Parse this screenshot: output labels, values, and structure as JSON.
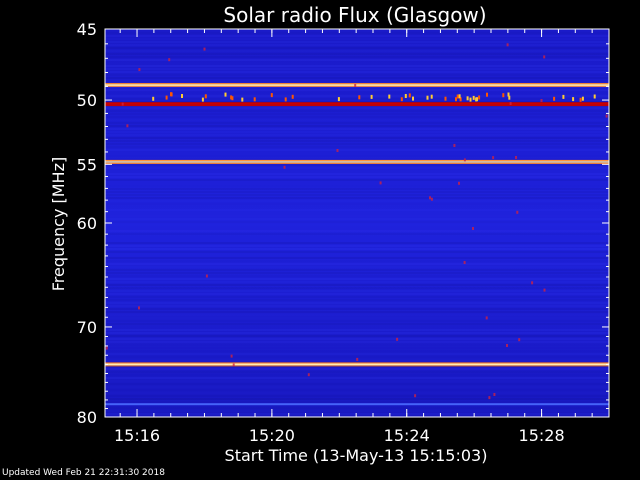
{
  "chart_data": {
    "type": "heatmap",
    "title": "Solar radio Flux (Glasgow)",
    "xlabel": "Start Time (13-May-13 15:15:03)",
    "ylabel": "Frequency [MHz]",
    "x_ticks": [
      "15:16",
      "15:20",
      "15:24",
      "15:28"
    ],
    "y_ticks": [
      45,
      50,
      55,
      60,
      70,
      80
    ],
    "ylim": [
      80,
      45
    ],
    "y_scale": "log",
    "xlim": [
      "15:15:03",
      "15:30:00"
    ],
    "colors": {
      "background": "#1a1adc",
      "hot": "#ffffff",
      "warm": "#ffaa00",
      "medium": "#cc0000"
    },
    "bright_bands_mhz": [
      {
        "freq": 48.9,
        "level": "hot"
      },
      {
        "freq": 50.3,
        "level": "medium"
      },
      {
        "freq": 54.8,
        "level": "hot"
      },
      {
        "freq": 74.0,
        "level": "hot"
      },
      {
        "freq": 78.5,
        "level": "faint"
      }
    ]
  },
  "footer": {
    "updated": "Updated Wed Feb 21 22:31:30 2018"
  }
}
